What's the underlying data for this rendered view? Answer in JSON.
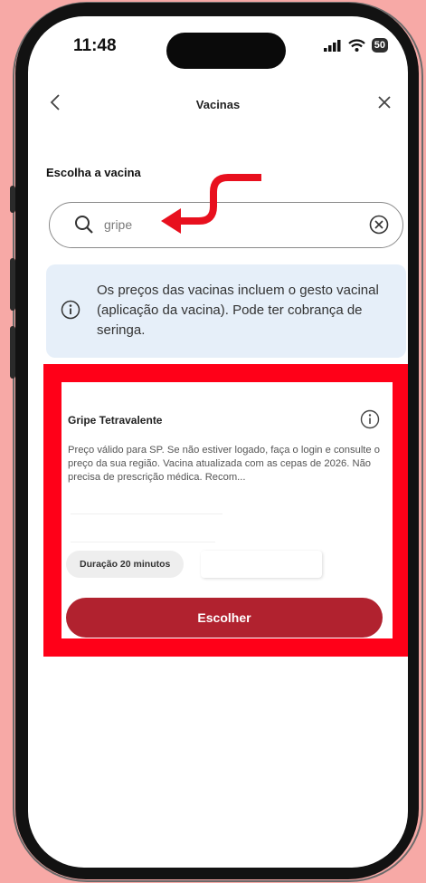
{
  "status_bar": {
    "time": "11:48",
    "battery": "50"
  },
  "nav": {
    "title": "Vacinas",
    "back_icon": "chevron-left-icon",
    "close_icon": "close-icon"
  },
  "search": {
    "label": "Escolha a vacina",
    "value": "gripe"
  },
  "notice": {
    "text": "Os preços das vacinas incluem o gesto vacinal (aplicação da vacina). Pode ter cobrança de seringa."
  },
  "vaccine_card": {
    "title": "Gripe Tetravalente",
    "description": "Preço válido para SP. Se não estiver logado, faça o login e consulte o preço da sua região. Vacina atualizada com as cepas de 2026. Não precisa de prescrição médica. Recom...",
    "duration": "Duração 20 minutos",
    "choose_label": "Escolher"
  },
  "colors": {
    "background": "#f7a9a6",
    "highlight": "#ff0018",
    "primary_button": "#b1222f",
    "info_box": "#e6eff9",
    "annotation_arrow": "#e8101e"
  }
}
